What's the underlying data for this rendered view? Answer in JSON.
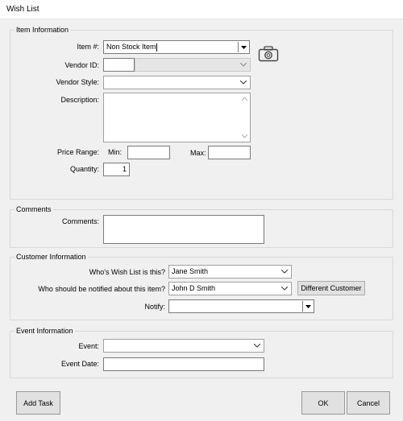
{
  "window": {
    "title": "Wish List"
  },
  "item_info": {
    "group_label": "Item Information",
    "item_label": "Item #:",
    "item_value": "Non Stock Item",
    "vendor_id_label": "Vendor ID:",
    "vendor_id_value": "",
    "vendor_style_label": "Vendor Style:",
    "vendor_style_value": "",
    "description_label": "Description:",
    "description_value": "",
    "price_range_label": "Price Range:",
    "min_label": "Min:",
    "min_value": "",
    "max_label": "Max:",
    "max_value": "",
    "quantity_label": "Quantity:",
    "quantity_value": "1"
  },
  "comments": {
    "group_label": "Comments",
    "comments_label": "Comments:",
    "comments_value": ""
  },
  "customer_info": {
    "group_label": "Customer Information",
    "wishlist_label": "Who's Wish List is this?",
    "wishlist_value": "Jane Smith",
    "notified_label": "Who should be notified about this item?",
    "notified_value": "John D Smith",
    "different_customer_label": "Different Customer",
    "notify_label": "Notify:",
    "notify_value": ""
  },
  "event_info": {
    "group_label": "Event Information",
    "event_label": "Event:",
    "event_value": "",
    "event_date_label": "Event Date:",
    "event_date_value": ""
  },
  "footer": {
    "add_task_label": "Add Task",
    "ok_label": "OK",
    "cancel_label": "Cancel"
  },
  "icons": {
    "camera": "camera-icon"
  }
}
